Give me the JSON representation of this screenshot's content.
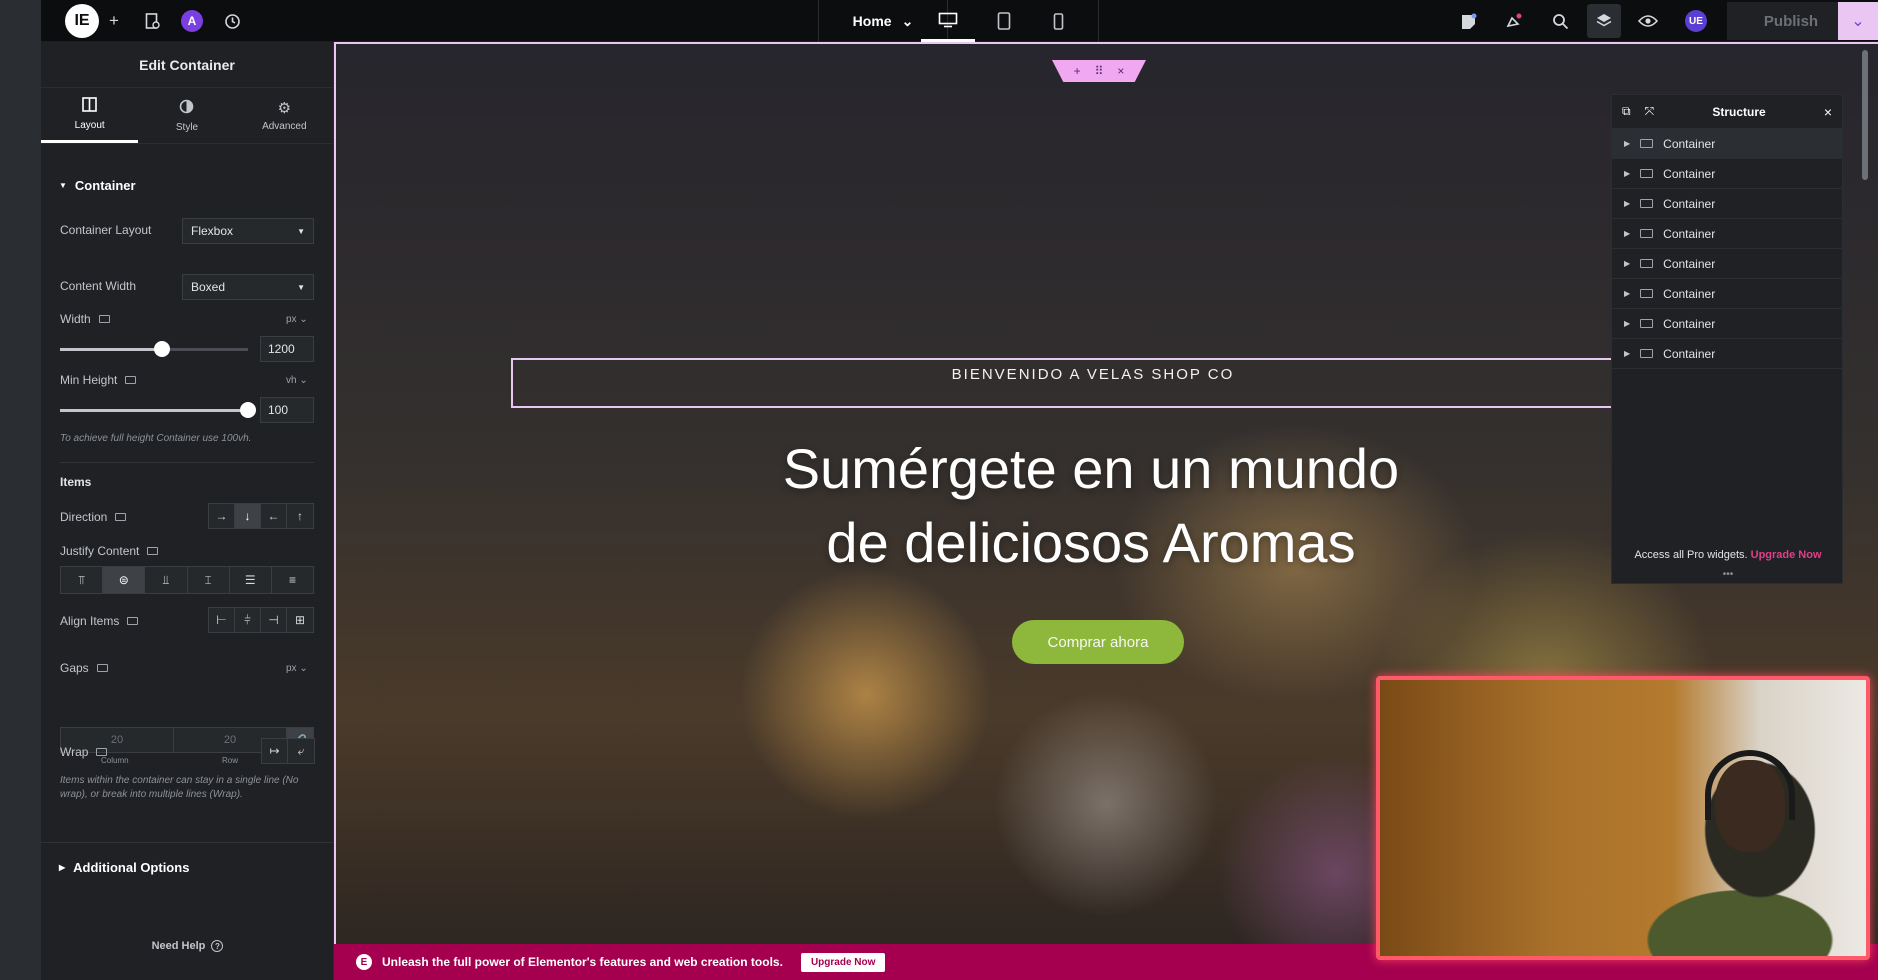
{
  "topbar": {
    "logo_glyph": "IE",
    "ai_glyph": "A",
    "page": "Home",
    "user_initials": "UE",
    "publish_label": "Publish"
  },
  "panel": {
    "title": "Edit Container",
    "tabs": [
      {
        "label": "Layout",
        "icon": "layout-icon"
      },
      {
        "label": "Style",
        "icon": "style-icon"
      },
      {
        "label": "Advanced",
        "icon": "gear-icon"
      }
    ],
    "section_container": "Container",
    "container_layout_label": "Container Layout",
    "container_layout_value": "Flexbox",
    "content_width_label": "Content Width",
    "content_width_value": "Boxed",
    "width_label": "Width",
    "width_unit": "px",
    "width_value": "1200",
    "width_slider_fraction": 0.54,
    "min_height_label": "Min Height",
    "min_height_unit": "vh",
    "min_height_value": "100",
    "min_height_slider_fraction": 1.0,
    "min_height_hint": "To achieve full height Container use 100vh.",
    "items_label": "Items",
    "direction_label": "Direction",
    "direction_options": [
      "→",
      "↓",
      "←",
      "↑"
    ],
    "direction_selected": 1,
    "justify_label": "Justify Content",
    "justify_selected": 1,
    "align_label": "Align Items",
    "gaps_label": "Gaps",
    "gaps_unit": "px",
    "gap_column": "20",
    "gap_row": "20",
    "gap_column_label": "Column",
    "gap_row_label": "Row",
    "wrap_label": "Wrap",
    "wrap_hint": "Items within the container can stay in a single line (No wrap), or break into multiple lines (Wrap).",
    "additional_options": "Additional Options",
    "need_help": "Need Help"
  },
  "canvas": {
    "welcome": "BIENVENIDO A VELAS SHOP CO",
    "title_line1": "Sumérgete en un mundo",
    "title_line2": "de deliciosos Aromas",
    "cta_label": "Comprar ahora"
  },
  "structure": {
    "title": "Structure",
    "items": [
      "Container",
      "Container",
      "Container",
      "Container",
      "Container",
      "Container",
      "Container",
      "Container"
    ],
    "promo_text": "Access all Pro widgets.",
    "promo_link": "Upgrade Now"
  },
  "promo_bar": {
    "text": "Unleash the full power of Elementor's features and web creation tools.",
    "button": "Upgrade Now"
  },
  "colors": {
    "accent": "#e9c7f2",
    "cta_green": "#8db83c",
    "promo_magenta": "#a4004f",
    "webcam_border": "#ff5a6a"
  }
}
